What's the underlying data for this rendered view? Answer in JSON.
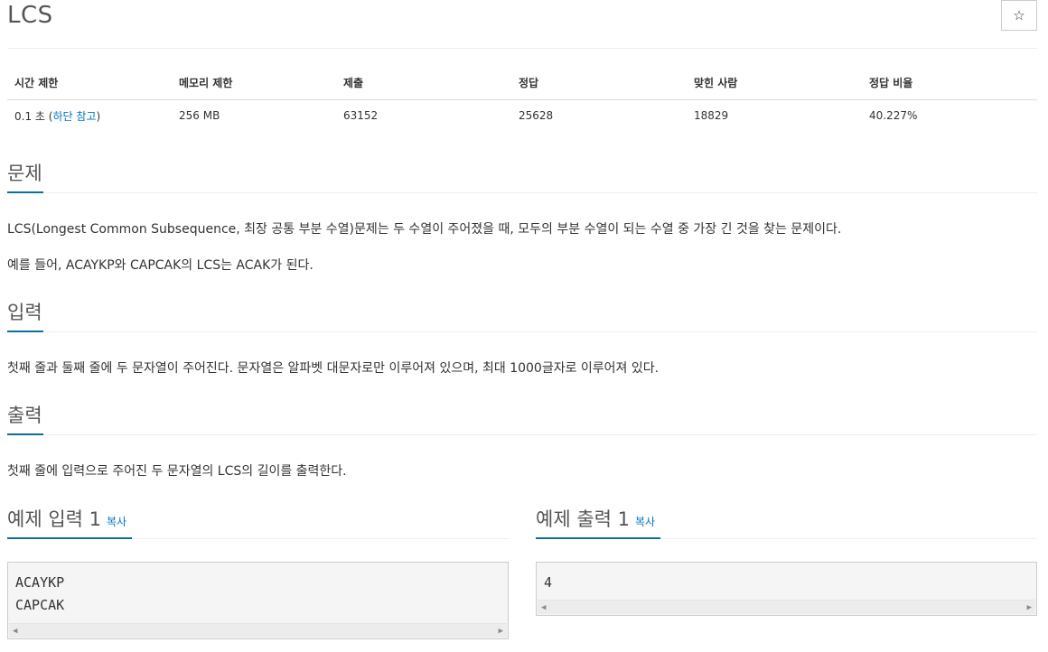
{
  "problem": {
    "title": "LCS",
    "star_icon": "☆"
  },
  "stats": {
    "headers": [
      "시간 제한",
      "메모리 제한",
      "제출",
      "정답",
      "맞힌 사람",
      "정답 비율"
    ],
    "time_limit": "0.1 초",
    "time_note_open": " (",
    "time_note_link": "하단 참고",
    "time_note_close": ")",
    "memory_limit": "256 MB",
    "submissions": "63152",
    "accepted": "25628",
    "solvers": "18829",
    "ratio": "40.227%"
  },
  "description": {
    "heading": "문제",
    "paragraphs": [
      "LCS(Longest Common Subsequence, 최장 공통 부분 수열)문제는 두 수열이 주어졌을 때, 모두의 부분 수열이 되는 수열 중 가장 긴 것을 찾는 문제이다.",
      "예를 들어, ACAYKP와 CAPCAK의 LCS는 ACAK가 된다."
    ]
  },
  "input": {
    "heading": "입력",
    "text": "첫째 줄과 둘째 줄에 두 문자열이 주어진다. 문자열은 알파벳 대문자로만 이루어져 있으며, 최대 1000글자로 이루어져 있다."
  },
  "output": {
    "heading": "출력",
    "text": "첫째 줄에 입력으로 주어진 두 문자열의 LCS의 길이를 출력한다."
  },
  "sample_input": {
    "heading": "예제 입력 1",
    "copy_label": "복사",
    "lines": [
      "ACAYKP",
      "CAPCAK"
    ]
  },
  "sample_output": {
    "heading": "예제 출력 1",
    "copy_label": "복사",
    "lines": [
      "4"
    ]
  },
  "scroll": {
    "left_arrow": "◀",
    "right_arrow": "▶"
  }
}
